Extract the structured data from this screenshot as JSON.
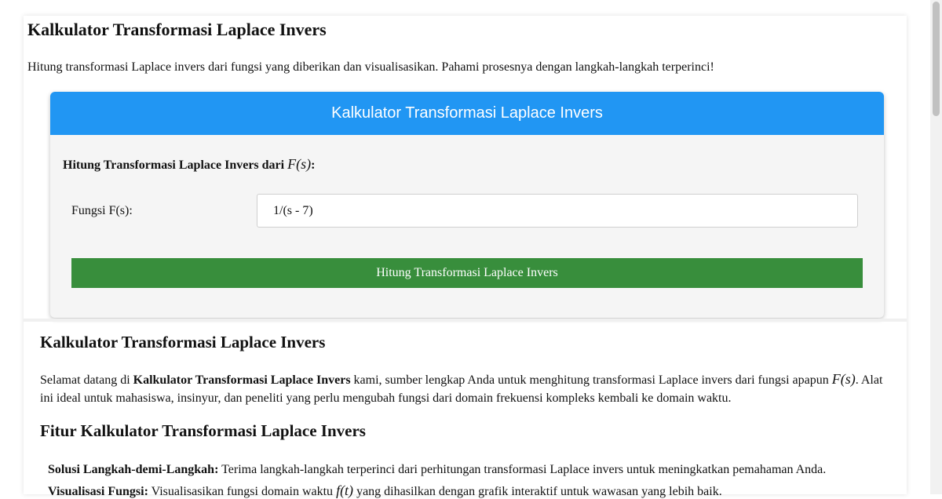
{
  "header": {
    "title": "Kalkulator Transformasi Laplace Invers",
    "subtitle": "Hitung transformasi Laplace invers dari fungsi yang diberikan dan visualisasikan. Pahami prosesnya dengan langkah-langkah terperinci!"
  },
  "calculator": {
    "card_title": "Kalkulator Transformasi Laplace Invers",
    "heading_text": "Hitung Transformasi Laplace Invers dari",
    "heading_math": "F(s)",
    "heading_suffix": ":",
    "input_label": "Fungsi F(s):",
    "input_value": "1/(s - 7)",
    "button_label": "Hitung Transformasi Laplace Invers"
  },
  "article": {
    "title": "Kalkulator Transformasi Laplace Invers",
    "intro_prefix": "Selamat datang di ",
    "intro_bold": "Kalkulator Transformasi Laplace Invers",
    "intro_middle": " kami, sumber lengkap Anda untuk menghitung transformasi Laplace invers dari fungsi apapun ",
    "intro_math": "F(s)",
    "intro_suffix": ". Alat ini ideal untuk mahasiswa, insinyur, dan peneliti yang perlu mengubah fungsi dari domain frekuensi kompleks kembali ke domain waktu.",
    "features_title": "Fitur Kalkulator Transformasi Laplace Invers",
    "features": [
      {
        "bold": "Solusi Langkah-demi-Langkah:",
        "text": " Terima langkah-langkah terperinci dari perhitungan transformasi Laplace invers untuk meningkatkan pemahaman Anda."
      },
      {
        "bold": "Visualisasi Fungsi:",
        "text_before": " Visualisasikan fungsi domain waktu ",
        "math": "f(t)",
        "text_after": " yang dihasilkan dengan grafik interaktif untuk wawasan yang lebih baik."
      }
    ]
  },
  "colors": {
    "card_header": "#2196f3",
    "button": "#388e3c"
  }
}
